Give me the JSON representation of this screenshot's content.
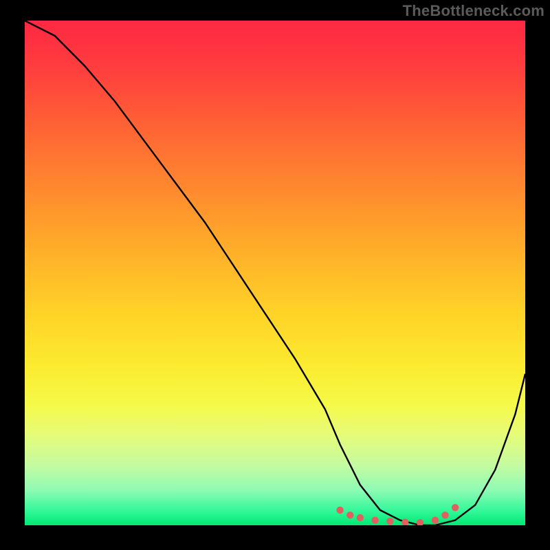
{
  "watermark": "TheBottleneck.com",
  "chart_data": {
    "type": "line",
    "title": "",
    "xlabel": "",
    "ylabel": "",
    "xlim": [
      0,
      100
    ],
    "ylim": [
      0,
      100
    ],
    "series": [
      {
        "name": "bottleneck-curve",
        "x": [
          0,
          6,
          12,
          18,
          24,
          30,
          36,
          42,
          48,
          54,
          60,
          63,
          67,
          71,
          75,
          79,
          82,
          86,
          90,
          94,
          98,
          100
        ],
        "values": [
          100,
          97,
          91,
          84,
          76,
          68,
          60,
          51,
          42,
          33,
          23,
          16,
          8,
          3,
          1,
          0,
          0,
          1,
          4,
          11,
          22,
          30
        ]
      }
    ],
    "annotations": [
      {
        "name": "red-dot-marker",
        "x": 63,
        "y": 3
      },
      {
        "name": "red-dot-marker",
        "x": 65,
        "y": 2
      },
      {
        "name": "red-dot-marker",
        "x": 67,
        "y": 1.5
      },
      {
        "name": "red-dot-marker",
        "x": 70,
        "y": 1
      },
      {
        "name": "red-dot-marker",
        "x": 73,
        "y": 0.8
      },
      {
        "name": "red-dot-marker",
        "x": 76,
        "y": 0.6
      },
      {
        "name": "red-dot-marker",
        "x": 79,
        "y": 0.5
      },
      {
        "name": "red-dot-marker",
        "x": 82,
        "y": 1
      },
      {
        "name": "red-dot-marker",
        "x": 84,
        "y": 2
      },
      {
        "name": "red-dot-marker",
        "x": 86,
        "y": 3.5
      }
    ],
    "colors": {
      "curve": "#000000",
      "markers": "#e06060",
      "background_top": "#fe2842",
      "background_bottom": "#00e973",
      "frame": "#000000"
    }
  }
}
